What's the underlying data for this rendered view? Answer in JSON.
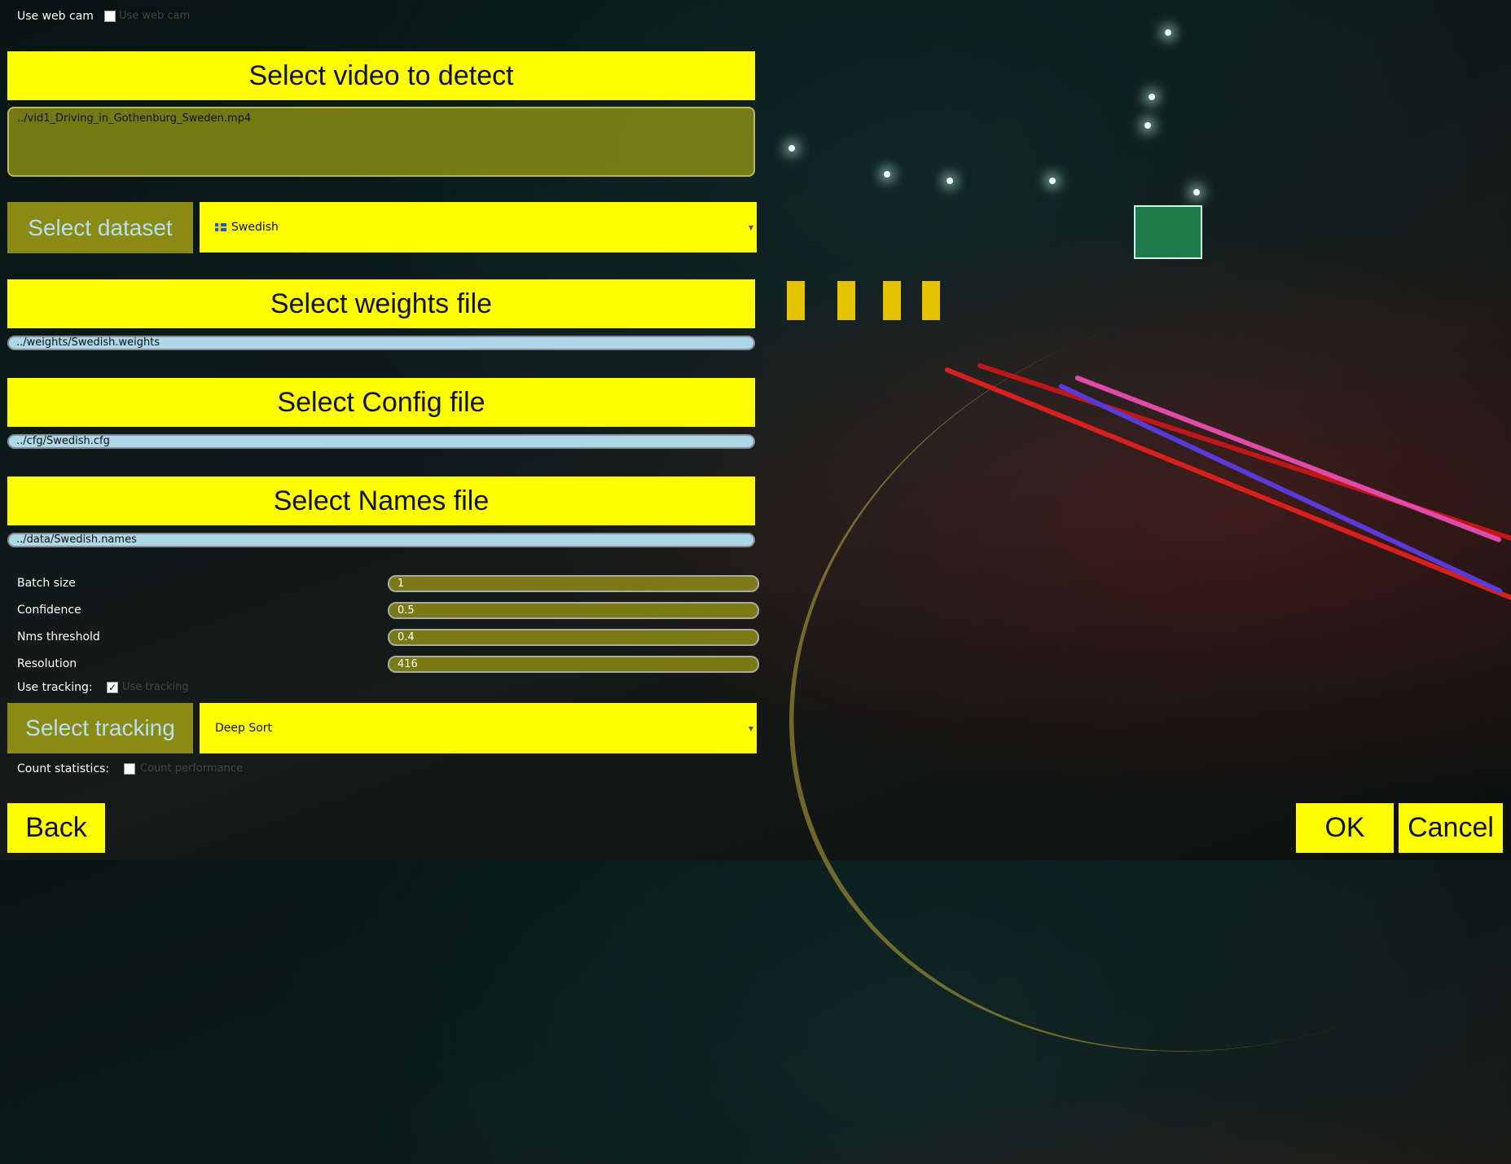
{
  "webcam": {
    "label": "Use web cam",
    "checkbox_text": "Use web cam",
    "checked": false
  },
  "video": {
    "button": "Select video to detect",
    "path": "../vid1_Driving_in_Gothenburg_Sweden.mp4"
  },
  "dataset": {
    "button": "Select dataset",
    "selected": "Swedish",
    "flag_icon": "sweden-flag-icon"
  },
  "weights": {
    "button": "Select weights file",
    "path": "../weights/Swedish.weights"
  },
  "config": {
    "button": "Select Config file",
    "path": "../cfg/Swedish.cfg"
  },
  "names": {
    "button": "Select Names file",
    "path": "../data/Swedish.names"
  },
  "params": {
    "batch_label": "Batch size",
    "batch_value": "1",
    "confidence_label": "Confidence",
    "confidence_value": "0.5",
    "nms_label": "Nms threshold",
    "nms_value": "0.4",
    "resolution_label": "Resolution",
    "resolution_value": "416"
  },
  "tracking": {
    "use_label": "Use tracking:",
    "checkbox_text": "Use tracking",
    "checked": true,
    "checkmark": "✓",
    "button": "Select tracking",
    "selected": "Deep Sort"
  },
  "stats": {
    "label": "Count statistics:",
    "checkbox_text": "Count performance",
    "checked": false
  },
  "footer": {
    "back": "Back",
    "ok": "OK",
    "cancel": "Cancel"
  },
  "colors": {
    "accent": "#ffff00",
    "path_field": "#add8e6",
    "muted_button": "#8a8a14"
  }
}
